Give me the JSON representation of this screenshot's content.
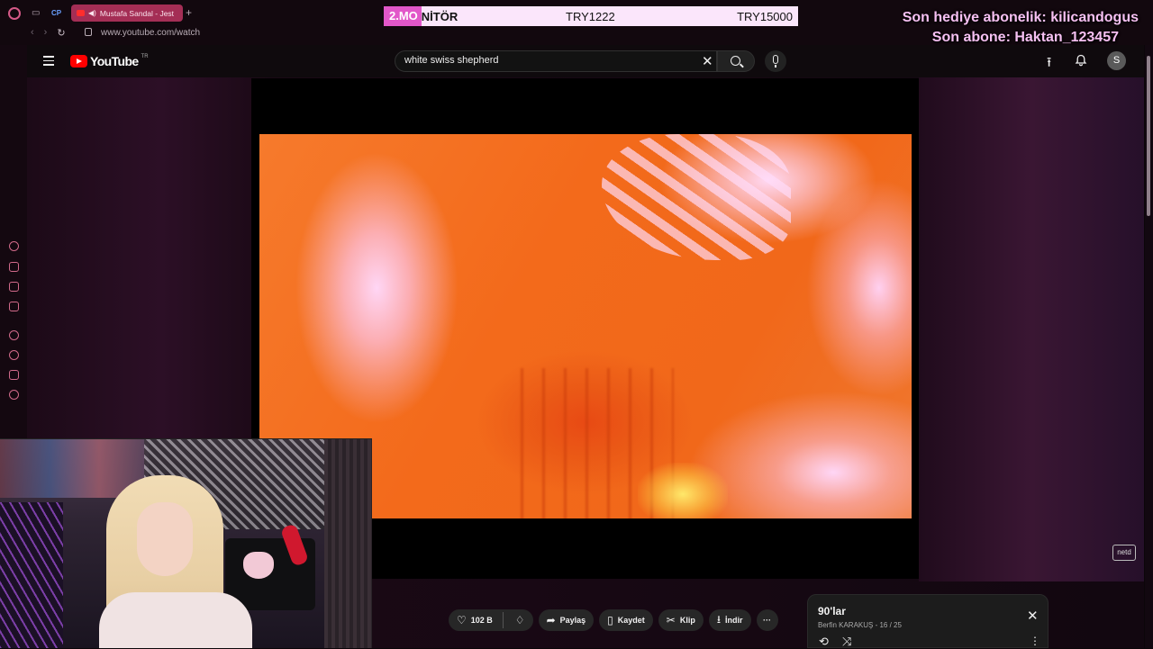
{
  "browser": {
    "tab_title": "Mustafa Sandal - Jest",
    "new_tab": "+",
    "url": "www.youtube.com/watch",
    "ext_label": "CP"
  },
  "overlay": {
    "monitor_label_a": "2.MO",
    "monitor_label_b": "NİTÖR",
    "try_a": "TRY1222",
    "try_b": "TRY15000",
    "last_gift": "Son hediye abonelik: kilicandogus",
    "last_sub": "Son abone: Haktan_123457"
  },
  "youtube": {
    "logo_text": "YouTube",
    "country_code": "TR",
    "search_value": "white swiss shepherd",
    "avatar_letter": "S",
    "watermark": "netd"
  },
  "actions": {
    "like_count": "102 B",
    "share": "Paylaş",
    "save": "Kaydet",
    "clip": "Klip",
    "download": "İndir",
    "more": "···"
  },
  "playlist": {
    "title": "90'lar",
    "owner_progress": "Berfin KARAKUŞ - 16 / 25"
  },
  "icons": {
    "close": "✕",
    "upload": "⭱",
    "like": "👍",
    "share": "➦",
    "save": "▯",
    "clip": "✂",
    "download": "⭳",
    "loop": "⟲",
    "shuffle": "⤨",
    "kebab": "⋮"
  },
  "colors": {
    "accent_pink": "#e257c9",
    "youtube_red": "#ff0000",
    "tab_active": "#a42e55"
  }
}
